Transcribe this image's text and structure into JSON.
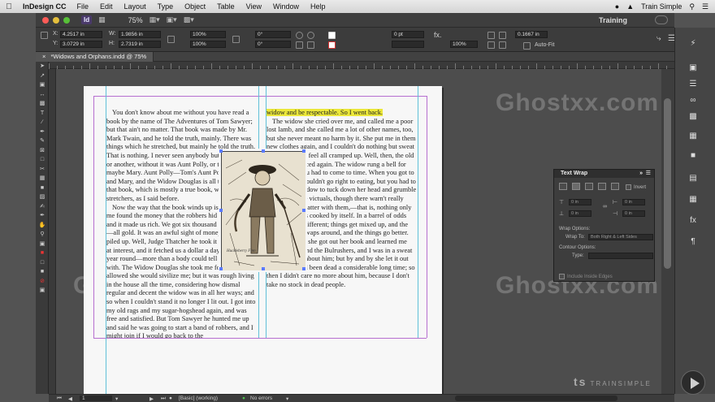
{
  "menubar": {
    "app_name": "InDesign CC",
    "items": [
      "File",
      "Edit",
      "Layout",
      "Type",
      "Object",
      "Table",
      "View",
      "Window",
      "Help"
    ],
    "workspace": "Training",
    "user": "Train Simple"
  },
  "app_bar": {
    "logo": "Id",
    "zoom": "75%"
  },
  "control_panel": {
    "x": "4.2517 in",
    "y": "3.0729 in",
    "w": "1.9856 in",
    "h": "2.7319 in",
    "scale_x": "100%",
    "scale_y": "100%",
    "rotate": "0°",
    "shear": "0°",
    "stroke_weight": "0 pt",
    "fitting_offset": "0.1667 in",
    "opacity": "100%",
    "auto_fit": "Auto-Fit"
  },
  "document_tab": {
    "title": "*Widows and Orphans.indd @ 75%"
  },
  "left_column": [
    "You don't know about me without you have read a book by the name of The Adventures of Tom Sawyer; but that ain't no matter. That book was made by Mr. Mark Twain, and he told the truth, mainly. There was things which he stretched, but mainly he told the truth. That is nothing. I never seen anybody but lied one time or another, without it was Aunt Polly, or the widow, or maybe Mary. Aunt Polly—Tom's Aunt Polly, she is—and Mary, and the Widow Douglas is all told about in that book, which is mostly a true book, with some stretchers, as I said before.",
    "Now the way that the book winds up is this: Tom and me found the money that the robbers hid in the cave, and it made us rich. We got six thousand dollars apiece—all gold. It was an awful sight of money when it was piled up. Well, Judge Thatcher he took it and put it out at interest, and it fetched us a dollar a day apiece all the year round—more than a body could tell what to do with. The Widow Douglas she took me for her son, and allowed she would sivilize me; but it was rough living in the house all the time, considering how dismal regular and decent the widow was in all her ways; and so when I couldn't stand it no longer I lit out. I got into my old rags and my sugar-hogshead again, and was free and satisfied. But Tom Sawyer he hunted me up and said he was going to start a band of robbers, and I might join if I would go back to the"
  ],
  "right_column": {
    "highlight": "widow and be respectable. So I went back.",
    "paragraph": "The widow she cried over me, and called me a poor lost lamb, and she called me a lot of other names, too, but she never meant no harm by it. She put me in them new clothes again, and I couldn't do nothing but sweat and sweat, and feel all cramped up. Well, then, the old thing commenced again. The widow rung a bell for supper, and you had to come to time. When you got to the table you couldn't go right to eating, but you had to wait for the widow to tuck down her head and grumble a little over the victuals, though there warn't really anything the matter with them,—that is, nothing only everything was cooked by itself. In a barrel of odds and ends it is different; things get mixed up, and the juice kind of swaps around, and the things go better.",
    "paragraph2": "After supper she got out her book and learned me about Moses and the Bulrushers, and I was in a sweat to find out all about him; but by and by she let it out that Moses had been dead a considerable long time; so then I didn't care no more about him, because I don't take no stock in dead people."
  },
  "image_caption": "Huckleberry Finn",
  "text_wrap_panel": {
    "title": "Text Wrap",
    "invert": "Invert",
    "top": "0 in",
    "bottom": "0 in",
    "left": "0 in",
    "right": "0 in",
    "wrap_options_label": "Wrap Options:",
    "wrap_to_label": "Wrap To:",
    "wrap_to_value": "Both Right & Left Sides",
    "contour_options_label": "Contour Options:",
    "type_label": "Type:",
    "include_inside_edges": "Include Inside Edges"
  },
  "status_bar": {
    "page": "1",
    "style": "[Basic] (working)",
    "preflight": "No errors"
  },
  "watermark": "Ghostxx.com",
  "brand": {
    "mark": "ts",
    "name": "TRAINSIMPLE"
  },
  "colors": {
    "highlight": "#ece83a",
    "margin_guide": "#b66fd0",
    "column_guide": "#60c0d8",
    "selection": "#5b7bff"
  }
}
